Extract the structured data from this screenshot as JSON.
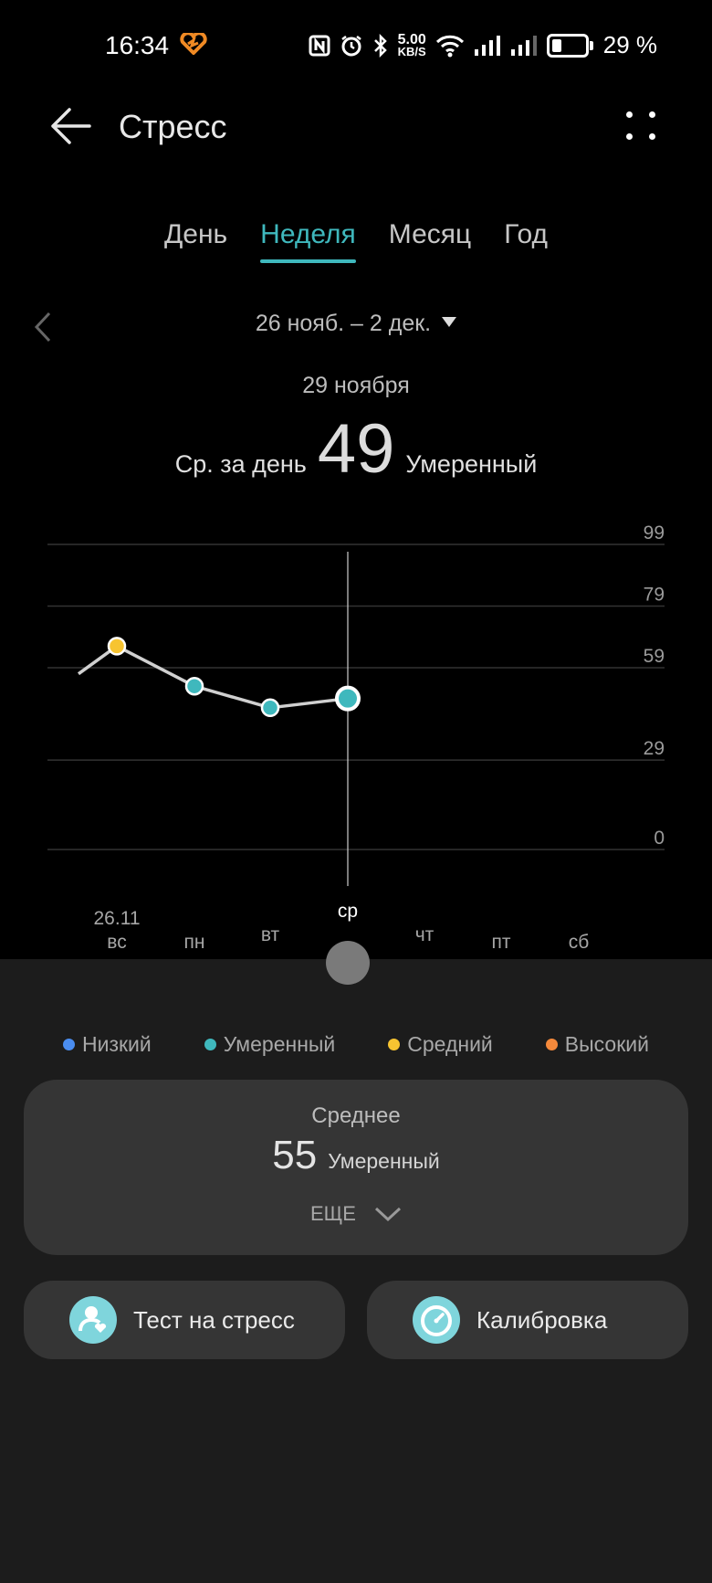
{
  "status_bar": {
    "time": "16:34",
    "speed_value": "5.00",
    "speed_unit": "KB/S",
    "battery": "29 %"
  },
  "header": {
    "title": "Стресс"
  },
  "tabs": [
    {
      "label": "День",
      "active": false
    },
    {
      "label": "Неделя",
      "active": true
    },
    {
      "label": "Месяц",
      "active": false
    },
    {
      "label": "Год",
      "active": false
    }
  ],
  "period": {
    "range": "26 нояб. – 2 дек."
  },
  "selected": {
    "date": "29 ноября",
    "label": "Ср. за день",
    "value": "49",
    "level": "Умеренный"
  },
  "chart_data": {
    "type": "line",
    "y_ticks": [
      99,
      79,
      59,
      29,
      0
    ],
    "ylim": [
      0,
      99
    ],
    "x_date_label": "26.11",
    "categories": [
      "вс",
      "пн",
      "вт",
      "ср",
      "чт",
      "пт",
      "сб"
    ],
    "selected_category": "ср",
    "series": [
      {
        "values": [
          66,
          53,
          46,
          49,
          null,
          null,
          null
        ]
      }
    ],
    "point_levels": [
      "Средний",
      "Умеренный",
      "Умеренный",
      "Умеренный"
    ],
    "colors": {
      "line": "#d0d0d0",
      "moderate": "#3fb8bd",
      "medium": "#f7c431",
      "grid": "#333333"
    }
  },
  "legend": [
    {
      "label": "Низкий",
      "color": "#4a8df0"
    },
    {
      "label": "Умеренный",
      "color": "#3fb8bd"
    },
    {
      "label": "Средний",
      "color": "#f7c431"
    },
    {
      "label": "Высокий",
      "color": "#f5893b"
    }
  ],
  "summary": {
    "label": "Среднее",
    "value": "55",
    "level": "Умеренный",
    "more": "ЕЩЕ"
  },
  "actions": {
    "stress_test": "Тест на стресс",
    "calibration": "Калибровка"
  }
}
